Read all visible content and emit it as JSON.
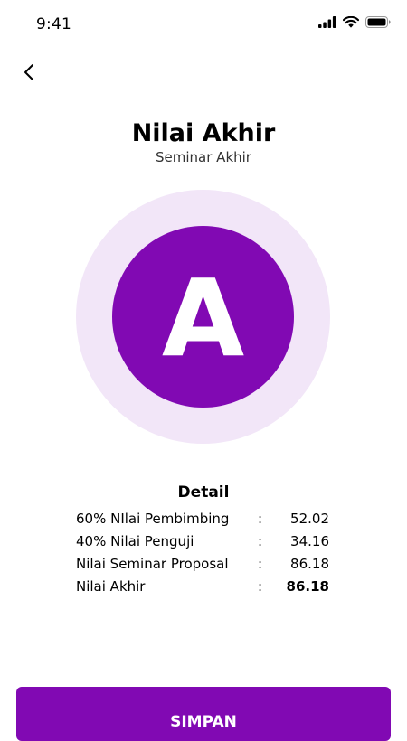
{
  "status_bar": {
    "time": "9:41",
    "icons": [
      "cellular-signal-icon",
      "wifi-icon",
      "battery-icon"
    ]
  },
  "header": {
    "back_icon": "chevron-left-icon",
    "title": "Nilai Akhir",
    "subtitle": "Seminar Akhir"
  },
  "grade": {
    "letter": "A",
    "colors": {
      "ring": "#f2e6f8",
      "circle": "#8109b3",
      "letter": "#ffffff"
    }
  },
  "detail": {
    "heading": "Detail",
    "separator": ":",
    "rows": [
      {
        "label": "60% NIlai Pembimbing",
        "value": "52.02"
      },
      {
        "label": "40% Nilai Penguji",
        "value": "34.16"
      },
      {
        "label": "Nilai Seminar Proposal",
        "value": "86.18"
      },
      {
        "label": "Nilai Akhir",
        "value": "86.18"
      }
    ]
  },
  "actions": {
    "save_label": "SIMPAN",
    "accent_color": "#8109b3"
  }
}
